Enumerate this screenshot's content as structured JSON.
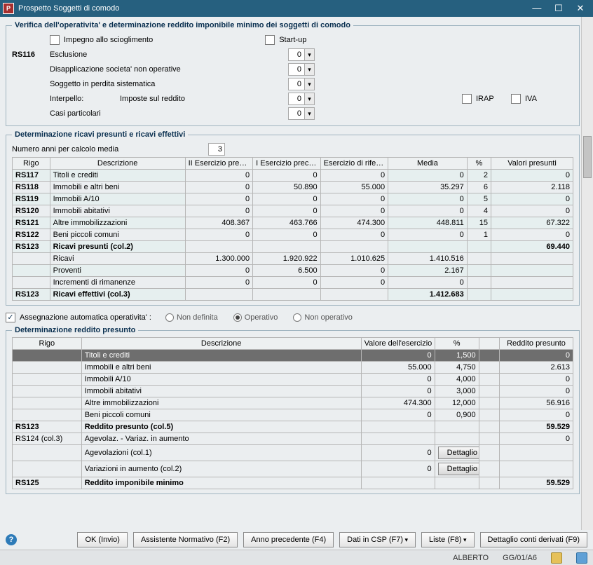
{
  "window": {
    "title": "Prospetto Soggetti di comodo"
  },
  "section1": {
    "legend": "Verifica dell'operativita' e determinazione reddito imponibile minimo dei soggetti di comodo",
    "impegno": "Impegno allo scioglimento",
    "startup": "Start-up",
    "code": "RS116",
    "rows": {
      "esclusione": "Esclusione",
      "disapp": "Disapplicazione societa' non operative",
      "perdita": "Soggetto in perdita sistematica",
      "interp": "Interpello:",
      "interp_sub": "Imposte sul reddito",
      "irap": "IRAP",
      "iva": "IVA",
      "casi": "Casi particolari"
    },
    "vals": {
      "v1": "0",
      "v2": "0",
      "v3": "0",
      "v4": "0",
      "v5": "0"
    }
  },
  "section2": {
    "legend": "Determinazione ricavi presunti e ricavi effettivi",
    "media_label": "Numero anni per calcolo media",
    "media_val": "3",
    "headers": {
      "rigo": "Rigo",
      "desc": "Descrizione",
      "e2": "II Esercizio precedente",
      "e1": "I Esercizio precedente",
      "er": "Esercizio di riferimento",
      "media": "Media",
      "pct": "%",
      "val": "Valori presunti"
    },
    "rows": [
      {
        "rigo": "RS117",
        "desc": "Titoli e crediti",
        "c": [
          "0",
          "0",
          "0",
          "0",
          "2",
          "0"
        ],
        "blue": true
      },
      {
        "rigo": "RS118",
        "desc": "Immobili e altri beni",
        "c": [
          "0",
          "50.890",
          "55.000",
          "35.297",
          "6",
          "2.118"
        ]
      },
      {
        "rigo": "RS119",
        "desc": "Immobili A/10",
        "c": [
          "0",
          "0",
          "0",
          "0",
          "5",
          "0"
        ],
        "blue": true
      },
      {
        "rigo": "RS120",
        "desc": "Immobili abitativi",
        "c": [
          "0",
          "0",
          "0",
          "0",
          "4",
          "0"
        ]
      },
      {
        "rigo": "RS121",
        "desc": "Altre immobilizzazioni",
        "c": [
          "408.367",
          "463.766",
          "474.300",
          "448.811",
          "15",
          "67.322"
        ],
        "blue": true
      },
      {
        "rigo": "RS122",
        "desc": "Beni piccoli comuni",
        "c": [
          "0",
          "0",
          "0",
          "0",
          "1",
          "0"
        ]
      },
      {
        "rigo": "RS123",
        "desc": "Ricavi presunti (col.2)",
        "c": [
          "",
          "",
          "",
          "",
          "",
          "69.440"
        ],
        "bold": true,
        "blue": true
      },
      {
        "rigo": "",
        "desc": "Ricavi",
        "c": [
          "1.300.000",
          "1.920.922",
          "1.010.625",
          "1.410.516",
          "",
          ""
        ]
      },
      {
        "rigo": "",
        "desc": "Proventi",
        "c": [
          "0",
          "6.500",
          "0",
          "2.167",
          "",
          ""
        ],
        "blue": true
      },
      {
        "rigo": "",
        "desc": "Incrementi di rimanenze",
        "c": [
          "0",
          "0",
          "0",
          "0",
          "",
          ""
        ]
      },
      {
        "rigo": "RS123",
        "desc": "Ricavi effettivi (col.3)",
        "c": [
          "",
          "",
          "",
          "1.412.683",
          "",
          ""
        ],
        "bold": true,
        "blue": true
      }
    ]
  },
  "assegn": {
    "label": "Assegnazione automatica operativita' :",
    "opts": [
      "Non definita",
      "Operativo",
      "Non operativo"
    ],
    "sel": 1
  },
  "section3": {
    "legend": "Determinazione reddito presunto",
    "headers": {
      "rigo": "Rigo",
      "desc": "Descrizione",
      "val": "Valore dell'esercizio",
      "pct": "%",
      "red": "Reddito presunto"
    },
    "rows": [
      {
        "rigo": "",
        "desc": "Titoli e crediti",
        "val": "0",
        "pct": "1,500",
        "red": "0",
        "dark": true
      },
      {
        "rigo": "",
        "desc": "Immobili e altri beni",
        "val": "55.000",
        "pct": "4,750",
        "red": "2.613"
      },
      {
        "rigo": "",
        "desc": "Immobili A/10",
        "val": "0",
        "pct": "4,000",
        "red": "0"
      },
      {
        "rigo": "",
        "desc": "Immobili abitativi",
        "val": "0",
        "pct": "3,000",
        "red": "0"
      },
      {
        "rigo": "",
        "desc": "Altre immobilizzazioni",
        "val": "474.300",
        "pct": "12,000",
        "red": "56.916"
      },
      {
        "rigo": "",
        "desc": "Beni piccoli comuni",
        "val": "0",
        "pct": "0,900",
        "red": "0"
      },
      {
        "rigo": "RS123",
        "desc": "Reddito presunto (col.5)",
        "val": "",
        "pct": "",
        "red": "59.529",
        "bold": true
      },
      {
        "rigo": "RS124 (col.3)",
        "desc": "Agevolaz. - Variaz. in aumento",
        "val": "",
        "pct": "",
        "red": "0"
      },
      {
        "rigo": "",
        "desc": "Agevolazioni (col.1)",
        "val": "0",
        "pct": "",
        "red": "",
        "btn": "Dettaglio"
      },
      {
        "rigo": "",
        "desc": "Variazioni in aumento (col.2)",
        "val": "0",
        "pct": "",
        "red": "",
        "btn": "Dettaglio"
      },
      {
        "rigo": "RS125",
        "desc": "Reddito imponibile minimo",
        "val": "",
        "pct": "",
        "red": "59.529",
        "bold": true
      }
    ]
  },
  "buttons": {
    "ok": "OK (Invio)",
    "ass": "Assistente Normativo (F2)",
    "anno": "Anno precedente (F4)",
    "csp": "Dati in CSP (F7)",
    "liste": "Liste (F8)",
    "dett": "Dettaglio conti derivati (F9)"
  },
  "status": {
    "user": "ALBERTO",
    "code": "GG/01/A6"
  }
}
